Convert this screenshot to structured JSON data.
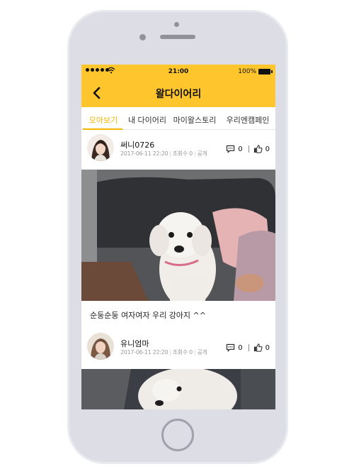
{
  "status_bar": {
    "time": "21:00",
    "battery": "100%"
  },
  "header": {
    "title": "왈다이어리"
  },
  "tabs": [
    {
      "label": "모아보기",
      "active": true
    },
    {
      "label": "내 다이어리",
      "active": false
    },
    {
      "label": "마이왈스토리",
      "active": false
    },
    {
      "label": "우리엔캠페인",
      "active": false
    }
  ],
  "posts": [
    {
      "author": "써니0726",
      "datetime": "2017-06-11 22:20",
      "views": "조회수 0",
      "visibility": "공개",
      "comments": "0",
      "likes": "0",
      "caption": "순둥순둥 여자여자 우리 강아지 ^^"
    },
    {
      "author": "유니엄마",
      "datetime": "2017-06-11 22:20",
      "views": "조회수 0",
      "visibility": "공개",
      "comments": "0",
      "likes": "0"
    }
  ],
  "colors": {
    "accent": "#fec62c",
    "tab_active": "#f2b600"
  },
  "icons": [
    "back-chevron-icon",
    "comment-icon",
    "thumbs-up-icon",
    "wifi-icon",
    "battery-icon",
    "signal-icon"
  ]
}
